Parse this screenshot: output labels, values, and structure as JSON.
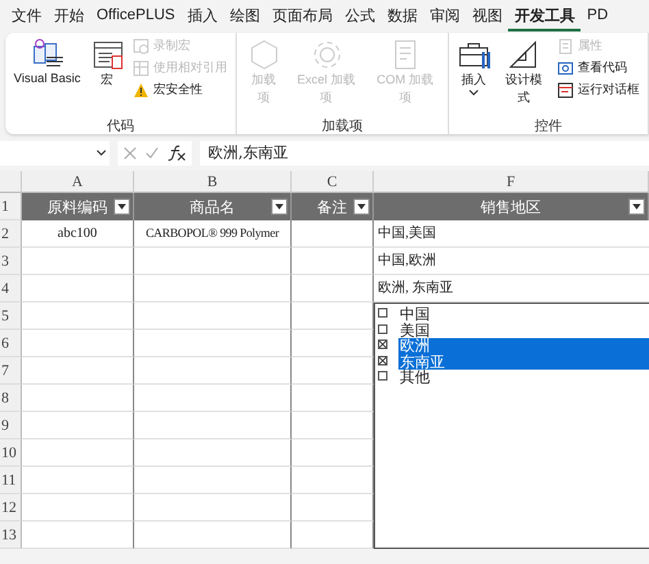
{
  "tabs": [
    {
      "label": "文件",
      "selected": false
    },
    {
      "label": "开始",
      "selected": false
    },
    {
      "label": "OfficePLUS",
      "selected": false
    },
    {
      "label": "插入",
      "selected": false
    },
    {
      "label": "绘图",
      "selected": false
    },
    {
      "label": "页面布局",
      "selected": false
    },
    {
      "label": "公式",
      "selected": false
    },
    {
      "label": "数据",
      "selected": false
    },
    {
      "label": "审阅",
      "selected": false
    },
    {
      "label": "视图",
      "selected": false
    },
    {
      "label": "开发工具",
      "selected": true
    },
    {
      "label": "PD",
      "selected": false
    }
  ],
  "ribbon_groups": [
    {
      "label": "代码",
      "items": [
        {
          "kind": "large",
          "label": "Visual Basic",
          "disabled": false
        },
        {
          "kind": "large",
          "label": "宏",
          "disabled": false
        },
        {
          "kind": "stack",
          "items": [
            {
              "label": "录制宏",
              "disabled": true
            },
            {
              "label": "使用相对引用",
              "disabled": true
            },
            {
              "label": "宏安全性",
              "disabled": false
            }
          ]
        }
      ]
    },
    {
      "label": "加载项",
      "items": [
        {
          "kind": "large",
          "label": "加载项",
          "disabled": true
        },
        {
          "kind": "large",
          "label": "Excel 加载项",
          "disabled": true
        },
        {
          "kind": "large",
          "label": "COM 加载项",
          "disabled": true
        }
      ]
    },
    {
      "label": "控件",
      "items": [
        {
          "kind": "menu",
          "label": "插入",
          "disabled": false
        },
        {
          "kind": "large",
          "label": "设计模式",
          "disabled": false
        },
        {
          "kind": "stack",
          "items": [
            {
              "label": "属性",
              "disabled": true
            },
            {
              "label": "查看代码",
              "disabled": false
            },
            {
              "label": "运行对话框",
              "disabled": false
            }
          ]
        }
      ]
    }
  ],
  "formula_bar": {
    "value": "欧洲,东南亚"
  },
  "sheet": {
    "columns": [
      "A",
      "B",
      "C",
      "F"
    ],
    "row_numbers": [
      "1",
      "2",
      "3",
      "4",
      "5",
      "6",
      "7",
      "8",
      "9",
      "10",
      "11",
      "12",
      "13"
    ],
    "headers": [
      "原料编码",
      "商品名",
      "备注",
      "销售地区"
    ],
    "rows": [
      {
        "code": "abc100",
        "product": "CARBOPOL® 999 Polymer",
        "region": "中国,美国"
      },
      {
        "region": "中国,欧洲"
      },
      {
        "region": "欧洲, 东南亚"
      }
    ],
    "listbox": [
      {
        "label": "中国",
        "checked": false,
        "selected": false
      },
      {
        "label": "美国",
        "checked": false,
        "selected": false
      },
      {
        "label": "欧洲",
        "checked": true,
        "selected": true
      },
      {
        "label": "东南亚",
        "checked": true,
        "selected": true
      },
      {
        "label": "其他",
        "checked": false,
        "selected": false
      }
    ]
  }
}
